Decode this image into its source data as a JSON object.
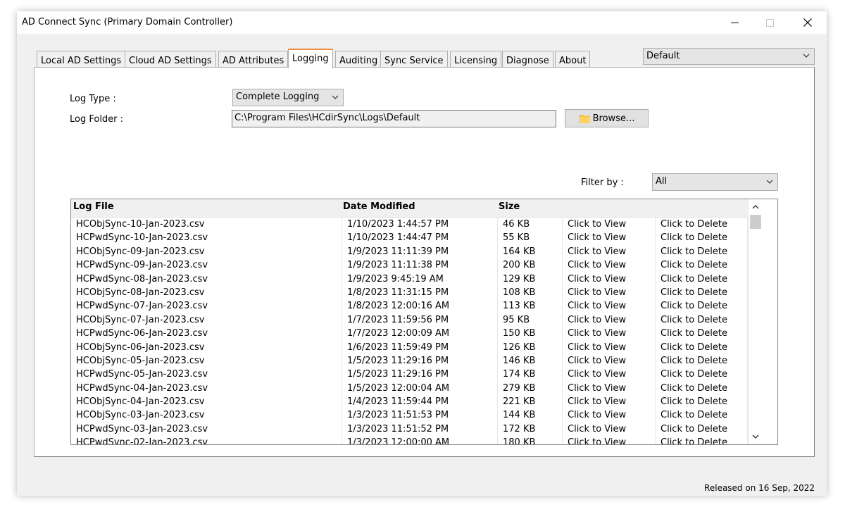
{
  "window": {
    "title": "AD Connect Sync (Primary Domain Controller)",
    "footer": "Released on 16 Sep, 2022"
  },
  "tabs": [
    {
      "label": "Local AD Settings"
    },
    {
      "label": "Cloud AD Settings"
    },
    {
      "label": "AD Attributes"
    },
    {
      "label": "Logging",
      "active": true
    },
    {
      "label": "Auditing"
    },
    {
      "label": "Sync Service"
    },
    {
      "label": "Licensing"
    },
    {
      "label": "Diagnose"
    },
    {
      "label": "About"
    }
  ],
  "profile": {
    "selected": "Default"
  },
  "logging": {
    "log_type_label": "Log Type :",
    "log_type_value": "Complete Logging",
    "log_folder_label": "Log Folder :",
    "log_folder_value": "C:\\Program Files\\HCdirSync\\Logs\\Default",
    "browse_label": "Browse...",
    "filter_label": "Filter by :",
    "filter_value": "All"
  },
  "table": {
    "columns": [
      "Log File",
      "Date Modified",
      "Size",
      "",
      ""
    ],
    "rows": [
      [
        "HCObjSync-10-Jan-2023.csv",
        "1/10/2023 1:44:57 PM",
        "46 KB",
        "Click to View",
        "Click to Delete"
      ],
      [
        "HCPwdSync-10-Jan-2023.csv",
        "1/10/2023 1:44:47 PM",
        "55 KB",
        "Click to View",
        "Click to Delete"
      ],
      [
        "HCObjSync-09-Jan-2023.csv",
        "1/9/2023 11:11:39 PM",
        "164 KB",
        "Click to View",
        "Click to Delete"
      ],
      [
        "HCPwdSync-09-Jan-2023.csv",
        "1/9/2023 11:11:38 PM",
        "200 KB",
        "Click to View",
        "Click to Delete"
      ],
      [
        "HCPwdSync-08-Jan-2023.csv",
        "1/9/2023 9:45:19 AM",
        "129 KB",
        "Click to View",
        "Click to Delete"
      ],
      [
        "HCObjSync-08-Jan-2023.csv",
        "1/8/2023 11:31:15 PM",
        "108 KB",
        "Click to View",
        "Click to Delete"
      ],
      [
        "HCPwdSync-07-Jan-2023.csv",
        "1/8/2023 12:00:16 AM",
        "113 KB",
        "Click to View",
        "Click to Delete"
      ],
      [
        "HCObjSync-07-Jan-2023.csv",
        "1/7/2023 11:59:56 PM",
        "95 KB",
        "Click to View",
        "Click to Delete"
      ],
      [
        "HCPwdSync-06-Jan-2023.csv",
        "1/7/2023 12:00:09 AM",
        "150 KB",
        "Click to View",
        "Click to Delete"
      ],
      [
        "HCObjSync-06-Jan-2023.csv",
        "1/6/2023 11:59:49 PM",
        "126 KB",
        "Click to View",
        "Click to Delete"
      ],
      [
        "HCObjSync-05-Jan-2023.csv",
        "1/5/2023 11:29:16 PM",
        "146 KB",
        "Click to View",
        "Click to Delete"
      ],
      [
        "HCPwdSync-05-Jan-2023.csv",
        "1/5/2023 11:29:16 PM",
        "174 KB",
        "Click to View",
        "Click to Delete"
      ],
      [
        "HCPwdSync-04-Jan-2023.csv",
        "1/5/2023 12:00:04 AM",
        "279 KB",
        "Click to View",
        "Click to Delete"
      ],
      [
        "HCObjSync-04-Jan-2023.csv",
        "1/4/2023 11:59:44 PM",
        "221 KB",
        "Click to View",
        "Click to Delete"
      ],
      [
        "HCObjSync-03-Jan-2023.csv",
        "1/3/2023 11:51:53 PM",
        "144 KB",
        "Click to View",
        "Click to Delete"
      ],
      [
        "HCPwdSync-03-Jan-2023.csv",
        "1/3/2023 11:51:52 PM",
        "172 KB",
        "Click to View",
        "Click to Delete"
      ],
      [
        "HCPwdSync-02-Jan-2023.csv",
        "1/3/2023 12:00:00 AM",
        "180 KB",
        "Click to View",
        "Click to Delete"
      ]
    ]
  }
}
